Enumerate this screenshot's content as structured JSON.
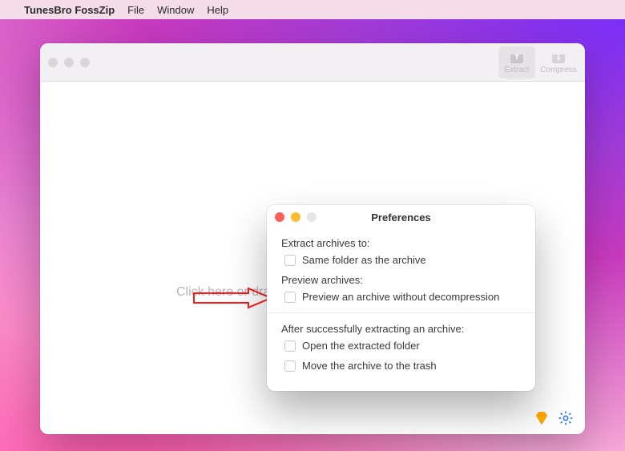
{
  "menubar": {
    "app_name": "TunesBro FossZip",
    "items": [
      "File",
      "Window",
      "Help"
    ]
  },
  "main_window": {
    "toolbar": {
      "extract_label": "Extract",
      "compress_label": "Compress"
    },
    "drop_hint": "Click here or dra",
    "icons": {
      "diamond": "sketch-diamond-icon",
      "gear": "settings-gear-icon"
    }
  },
  "preferences": {
    "title": "Preferences",
    "sections": {
      "extract_to": {
        "label": "Extract archives to:",
        "option_same_folder": "Same folder as the archive"
      },
      "preview": {
        "label": "Preview archives:",
        "option_preview_without_decomp": "Preview an archive without decompression"
      },
      "after_extract": {
        "label": "After successfully extracting an archive:",
        "option_open_folder": "Open the extracted folder",
        "option_move_trash": "Move the archive to the trash"
      }
    }
  }
}
